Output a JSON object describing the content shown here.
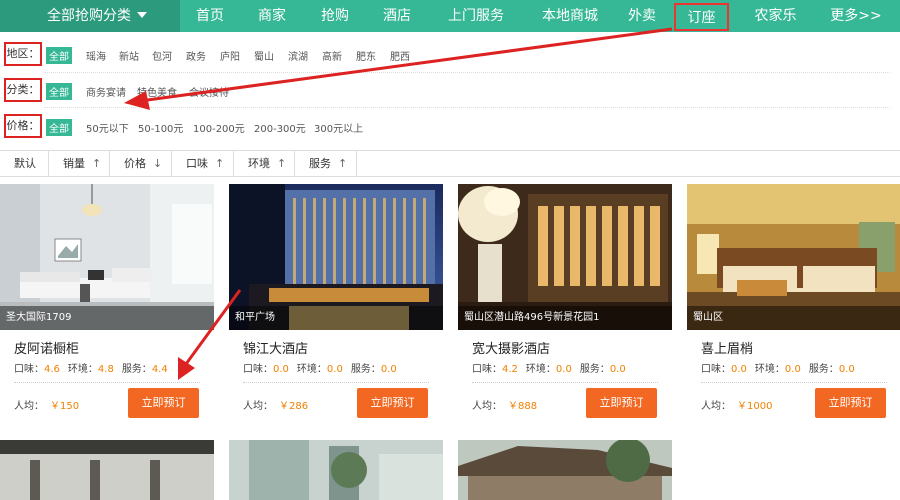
{
  "nav": {
    "category": "全部抢购分类",
    "items": [
      "首页",
      "商家",
      "抢购",
      "酒店",
      "上门服务",
      "本地商城",
      "外卖",
      "订座",
      "农家乐",
      "更多>>"
    ],
    "active": "订座"
  },
  "filters": {
    "region": {
      "label": "地区：",
      "all": "全部",
      "options": [
        "瑶海",
        "新站",
        "包河",
        "政务",
        "庐阳",
        "蜀山",
        "滨湖",
        "高新",
        "肥东",
        "肥西"
      ]
    },
    "category": {
      "label": "分类：",
      "all": "全部",
      "options": [
        "商务宴请",
        "特色美食",
        "会议接待"
      ]
    },
    "price": {
      "label": "价格：",
      "all": "全部",
      "options": [
        "50元以下",
        "50-100元",
        "100-200元",
        "200-300元",
        "300元以上"
      ]
    }
  },
  "sort": {
    "items": [
      {
        "label": "默认",
        "arrow": ""
      },
      {
        "label": "销量",
        "arrow": "↑"
      },
      {
        "label": "价格",
        "arrow": "↓"
      },
      {
        "label": "口味",
        "arrow": "↑"
      },
      {
        "label": "环境",
        "arrow": "↑"
      },
      {
        "label": "服务",
        "arrow": "↑"
      }
    ]
  },
  "cards": [
    {
      "location": "圣大国际1709",
      "name": "皮阿诺橱柜",
      "taste_label": "口味：",
      "taste": "4.6",
      "env_label": "环境：",
      "env": "4.8",
      "service_label": "服务：",
      "service": "4.4",
      "avg_label": "人均：",
      "price": "￥150",
      "button": "立即预订"
    },
    {
      "location": "和平广场",
      "name": "锦江大酒店",
      "taste_label": "口味：",
      "taste": "0.0",
      "env_label": "环境：",
      "env": "0.0",
      "service_label": "服务：",
      "service": "0.0",
      "avg_label": "人均：",
      "price": "￥286",
      "button": "立即预订"
    },
    {
      "location": "蜀山区潜山路496号新景花园1",
      "name": "宽大摄影酒店",
      "taste_label": "口味：",
      "taste": "4.2",
      "env_label": "环境：",
      "env": "0.0",
      "service_label": "服务：",
      "service": "0.0",
      "avg_label": "人均：",
      "price": "￥888",
      "button": "立即预订"
    },
    {
      "location": "蜀山区",
      "name": "喜上眉梢",
      "taste_label": "口味：",
      "taste": "0.0",
      "env_label": "环境：",
      "env": "0.0",
      "service_label": "服务：",
      "service": "0.0",
      "avg_label": "人均：",
      "price": "￥1000",
      "button": "立即预订"
    }
  ],
  "colors": {
    "nav": "#36b896",
    "nav_dark": "#2c9a7d",
    "accent": "#f26722",
    "rating": "#f08000",
    "annotation": "#dd2222"
  }
}
